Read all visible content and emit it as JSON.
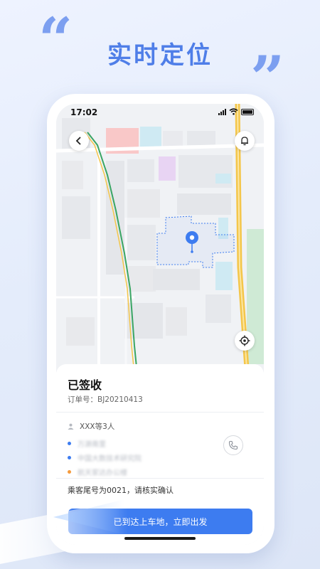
{
  "promo": {
    "headline": "实时定位",
    "quote_open": "“",
    "quote_close": "”"
  },
  "status_bar": {
    "time": "17:02"
  },
  "map": {
    "icons": {
      "back": "chevron-left-icon",
      "notification": "bell-icon",
      "locate": "crosshair-icon",
      "destination": "map-pin-icon"
    }
  },
  "order": {
    "status": "已签收",
    "order_label": "订单号：",
    "order_number": "BJ20210413",
    "passengers": "XXX等3人",
    "stops": [
      {
        "text": "万源南里",
        "dot_color": "#3d7cf0"
      },
      {
        "text": "中国大数技术研究院",
        "dot_color": "#3d7cf0"
      },
      {
        "text": "航天家达办公楼",
        "dot_color": "#f59a3c"
      }
    ],
    "notice": "乘客尾号为0021，请核实确认",
    "action_button": "已到达上车地，立即出发"
  },
  "colors": {
    "accent": "#3d7cf0",
    "headline": "#4f7ee8",
    "route_green": "#3aa564",
    "road_yellow": "#f4c64a"
  }
}
